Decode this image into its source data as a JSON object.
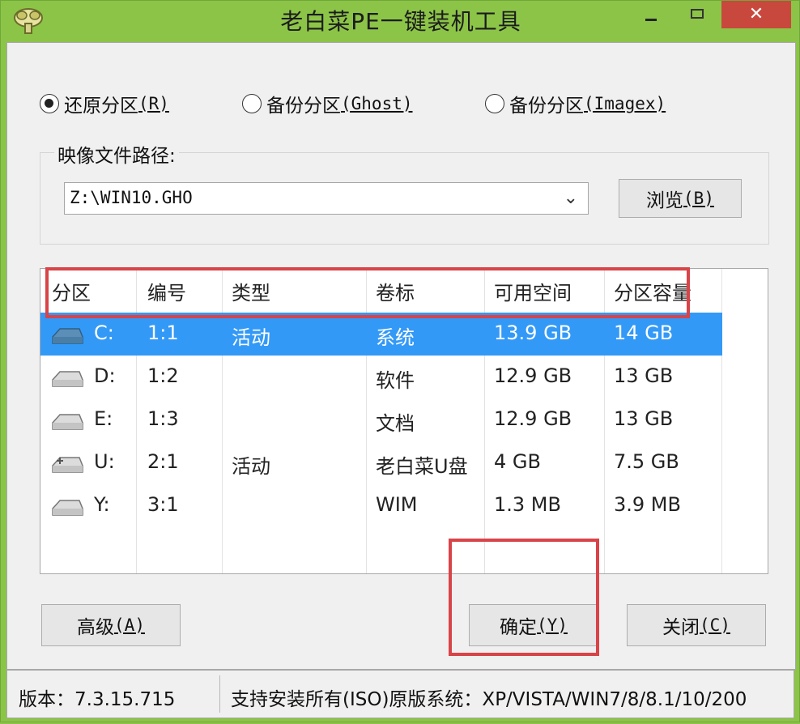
{
  "window": {
    "title": "老白菜PE一键装机工具",
    "close_glyph": "✕"
  },
  "modes": [
    {
      "label": "还原分区",
      "mnemonic": "(R)",
      "checked": true
    },
    {
      "label": "备份分区",
      "mnemonic": "(Ghost)",
      "checked": false
    },
    {
      "label": "备份分区",
      "mnemonic": "(Imagex)",
      "checked": false
    }
  ],
  "image_path": {
    "label": "映像文件路径:",
    "value": "Z:\\WIN10.GHO",
    "browse_label": "浏览",
    "browse_mnemonic": "(B)"
  },
  "table": {
    "headers": [
      "分区",
      "编号",
      "类型",
      "卷标",
      "可用空间",
      "分区容量"
    ],
    "rows": [
      {
        "partition": "C:",
        "number": "1:1",
        "type": "活动",
        "label": "系统",
        "free": "13.9 GB",
        "capacity": "14 GB",
        "selected": true,
        "icon": "drive-icon"
      },
      {
        "partition": "D:",
        "number": "1:2",
        "type": "",
        "label": "软件",
        "free": "12.9 GB",
        "capacity": "13 GB",
        "selected": false,
        "icon": "drive-icon"
      },
      {
        "partition": "E:",
        "number": "1:3",
        "type": "",
        "label": "文档",
        "free": "12.9 GB",
        "capacity": "13 GB",
        "selected": false,
        "icon": "drive-icon"
      },
      {
        "partition": "U:",
        "number": "2:1",
        "type": "活动",
        "label": "老白菜U盘",
        "free": "4 GB",
        "capacity": "7.5 GB",
        "selected": false,
        "icon": "usb-drive-icon"
      },
      {
        "partition": "Y:",
        "number": "3:1",
        "type": "",
        "label": "WIM",
        "free": "1.3 MB",
        "capacity": "3.9 MB",
        "selected": false,
        "icon": "drive-icon"
      }
    ]
  },
  "buttons": {
    "advanced": "高级",
    "advanced_mnemonic": "(A)",
    "ok": "确定",
    "ok_mnemonic": "(Y)",
    "close": "关闭",
    "close_mnemonic": "(C)"
  },
  "status": {
    "version": "版本：7.3.15.715",
    "support": "支持安装所有(ISO)原版系统：XP/VISTA/WIN7/8/8.1/10/200"
  },
  "colors": {
    "frame": "#8cc448",
    "selection": "#3399f7",
    "annotation": "#d84448"
  }
}
